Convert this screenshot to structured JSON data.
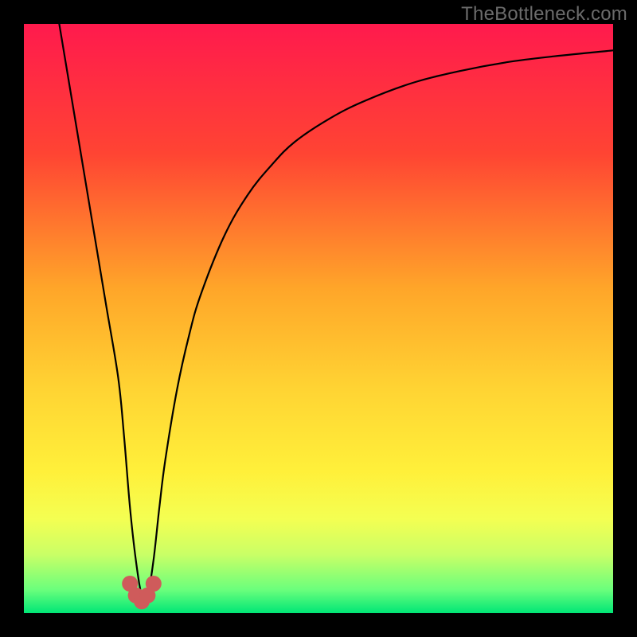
{
  "watermark": {
    "text": "TheBottleneck.com"
  },
  "chart_data": {
    "type": "line",
    "title": "",
    "xlabel": "",
    "ylabel": "",
    "xlim": [
      0,
      100
    ],
    "ylim": [
      0,
      100
    ],
    "x": [
      6,
      8,
      10,
      12,
      14,
      16,
      17,
      18,
      19,
      20,
      21,
      22,
      23,
      24,
      26,
      28,
      30,
      34,
      38,
      42,
      46,
      52,
      58,
      66,
      74,
      82,
      90,
      100
    ],
    "values": [
      100,
      88,
      76,
      64,
      52,
      40,
      30,
      18,
      9,
      3,
      3,
      9,
      18,
      26,
      38,
      47,
      54,
      64,
      71,
      76,
      80,
      84,
      87,
      90,
      92,
      93.5,
      94.5,
      95.5
    ],
    "gradient_stops": [
      {
        "pct": 0,
        "color": "#ff1a4d"
      },
      {
        "pct": 22,
        "color": "#ff4433"
      },
      {
        "pct": 45,
        "color": "#ffa629"
      },
      {
        "pct": 62,
        "color": "#ffd433"
      },
      {
        "pct": 76,
        "color": "#fff03a"
      },
      {
        "pct": 84,
        "color": "#f4ff52"
      },
      {
        "pct": 90,
        "color": "#caff66"
      },
      {
        "pct": 96,
        "color": "#6bff7c"
      },
      {
        "pct": 100,
        "color": "#00e676"
      }
    ],
    "markers": [
      {
        "x": 18,
        "y": 5
      },
      {
        "x": 19,
        "y": 3
      },
      {
        "x": 20,
        "y": 2
      },
      {
        "x": 21,
        "y": 3
      },
      {
        "x": 22,
        "y": 5
      }
    ],
    "marker_color": "#cf5b5b"
  }
}
